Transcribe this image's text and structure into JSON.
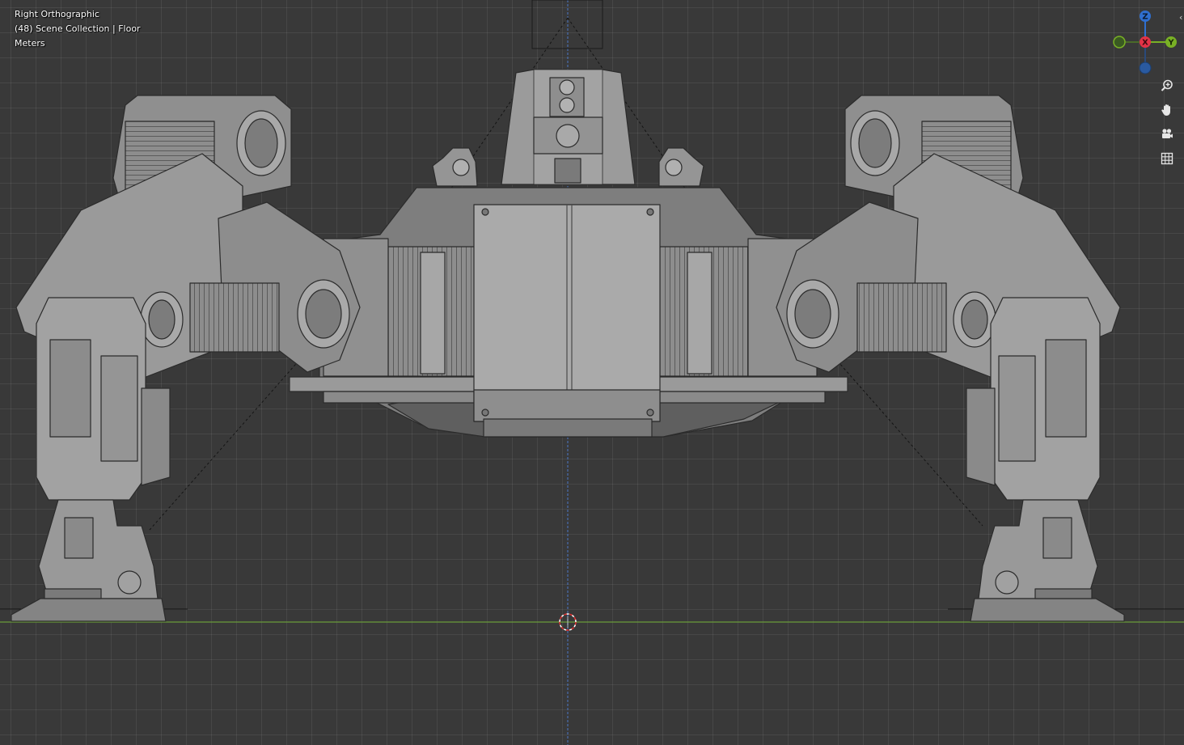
{
  "viewport": {
    "view_name": "Right Orthographic",
    "collection_info": "(48) Scene Collection | Floor",
    "units": "Meters"
  },
  "gizmo": {
    "axes": [
      {
        "label": "Z",
        "color": "#2f6fd0"
      },
      {
        "label": "X",
        "color": "#e33347"
      },
      {
        "label": "Y",
        "color": "#79b125"
      }
    ]
  },
  "navigation": {
    "buttons": [
      {
        "name": "zoom",
        "icon": "zoom-icon"
      },
      {
        "name": "pan",
        "icon": "hand-icon"
      },
      {
        "name": "camera",
        "icon": "camera-icon"
      },
      {
        "name": "perspective-toggle",
        "icon": "grid-icon"
      }
    ]
  },
  "colors": {
    "background": "#393939",
    "floor_axis": "#6a9a3a",
    "vertical_axis": "#4a78c8",
    "model_light": "#a4a4a4",
    "model_mid": "#8a8a8a",
    "model_dark": "#5e5e5e",
    "edges": "#2b2b2b",
    "cursor": "#e03030"
  }
}
